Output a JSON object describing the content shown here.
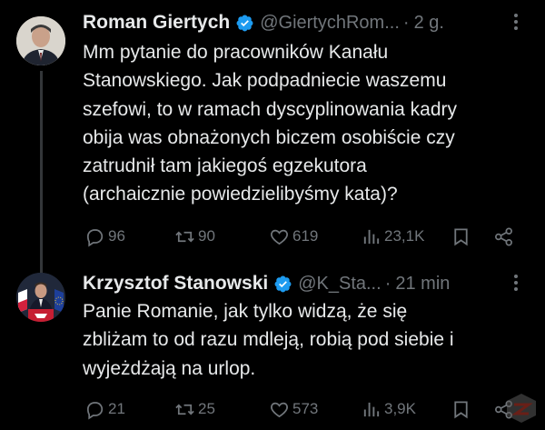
{
  "tweets": [
    {
      "author_name": "Roman Giertych",
      "handle": "@GiertychRom...",
      "separator": "·",
      "time": "2 g.",
      "text_lines": [
        "Mm pytanie do pracowników Kanału",
        "Stanowskiego. Jak podpadniecie waszemu",
        "szefowi, to w ramach dyscyplinowania kadry",
        "obija was obnażonych biczem osobiście czy",
        "zatrudnił tam jakiegoś egzekutora",
        "(archaicznie powiedzielibyśmy kata)?"
      ],
      "replies": "96",
      "retweets": "90",
      "likes": "619",
      "views": "23,1K"
    },
    {
      "author_name": "Krzysztof Stanowski",
      "handle": "@K_Sta...",
      "separator": "·",
      "time": "21 min",
      "text_lines": [
        "Panie Romanie, jak tylko widzą, że się",
        "zbliżam to od razu mdleją, robią pod siebie i",
        "wyjeżdżają na urlop."
      ],
      "replies": "21",
      "retweets": "25",
      "likes": "573",
      "views": "3,9K"
    }
  ],
  "icons": {
    "verified": "verified-badge-icon",
    "more": "more-options-icon",
    "reply": "reply-icon",
    "retweet": "retweet-icon",
    "like": "heart-icon",
    "views": "views-icon",
    "bookmark": "bookmark-icon",
    "share": "share-icon"
  },
  "colors": {
    "background": "#000000",
    "text": "#e7e9ea",
    "muted": "#71767b",
    "verified": "#1d9bf0",
    "thread_line": "#333639"
  }
}
